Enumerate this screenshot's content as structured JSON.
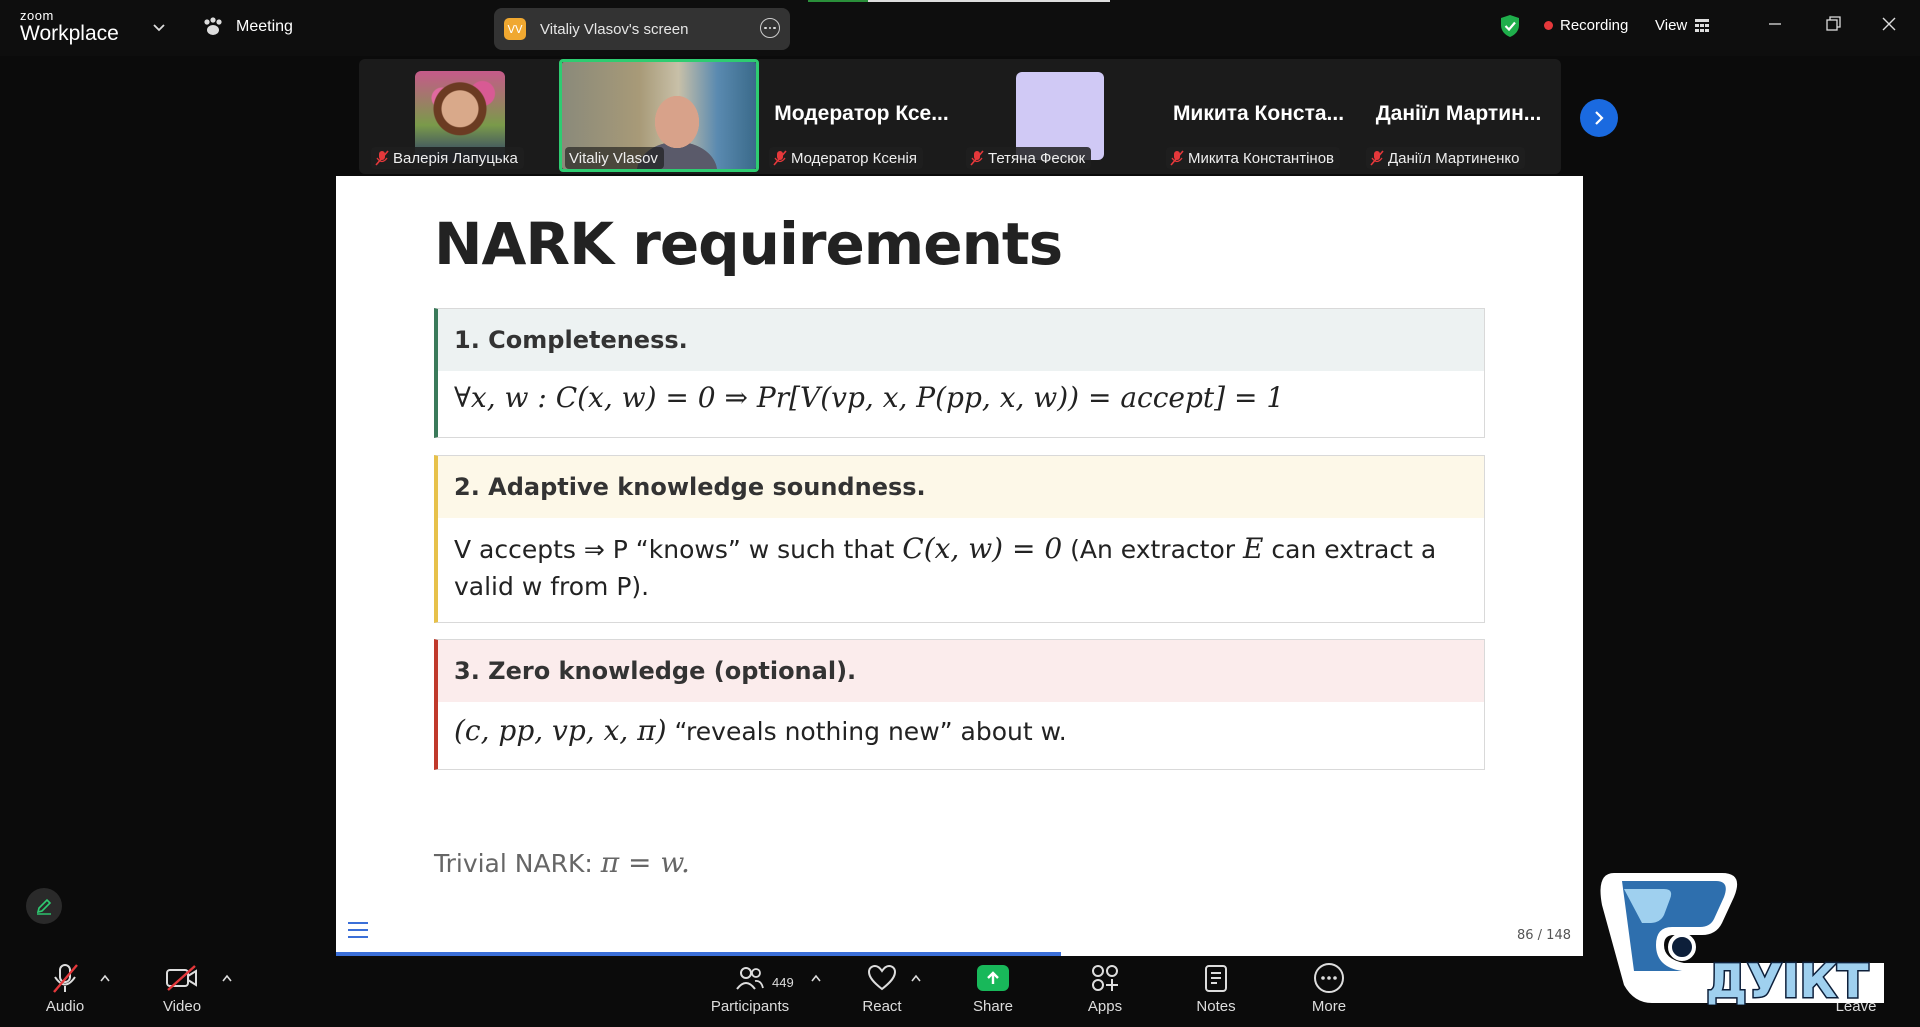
{
  "topbar": {
    "logo_small": "zoom",
    "logo_big": "Workplace",
    "meeting_label": "Meeting",
    "share_pill": {
      "initials": "VV",
      "label": "Vitaliy Vlasov's screen"
    },
    "recording_label": "Recording",
    "view_label": "View"
  },
  "participants_strip": [
    {
      "name": "Валерія Лапуцька",
      "muted": true
    },
    {
      "name": "Vitaliy Vlasov",
      "muted": false,
      "active_speaker": true
    },
    {
      "display": "Модератор Ксе...",
      "name": "Модератор Ксенія",
      "muted": true
    },
    {
      "name": "Тетяна Фесюк",
      "muted": true
    },
    {
      "display": "Микита Конста...",
      "name": "Микита Константінов",
      "muted": true
    },
    {
      "display": "Даніїл Мартин...",
      "name": "Даніїл Мартиненко",
      "muted": true
    }
  ],
  "slide": {
    "title": "NARK requirements",
    "blocks": [
      {
        "head": "1. Completeness.",
        "body_math": "∀x, w : C(x, w) = 0 ⇒ Pr[V(vp, x, P(pp, x, w)) = accept] = 1",
        "accent": "#3a7a5a",
        "head_bg": "#edf2f2"
      },
      {
        "head": "2. Adaptive knowledge soundness.",
        "body_pre": "V accepts ⇒ P “knows” w such that ",
        "body_math1": "C(x, w) = 0",
        "body_mid": " (An extractor ",
        "body_math2": "E",
        "body_post": " can extract a valid w from P).",
        "accent": "#e7c14a",
        "head_bg": "#fdf8e8"
      },
      {
        "head": "3. Zero knowledge (optional).",
        "body_math": "(c, pp, vp, x, π)",
        "body_post": " “reveals nothing new” about w.",
        "accent": "#c0392b",
        "head_bg": "#fbecec"
      }
    ],
    "trivial_text": "Trivial NARK: ",
    "trivial_math": "π = w.",
    "page_number": "86 / 148",
    "progress_fraction": 0.581
  },
  "toolbar": {
    "audio": "Audio",
    "video": "Video",
    "participants": "Participants",
    "participant_count": "449",
    "react": "React",
    "share": "Share",
    "apps": "Apps",
    "notes": "Notes",
    "more": "More",
    "leave": "Leave"
  },
  "watermark": {
    "text": "ДУІКТ"
  },
  "colors": {
    "share_green": "#18b85a",
    "active_border": "#2ecc71",
    "accent_blue": "#1a6ae0"
  }
}
